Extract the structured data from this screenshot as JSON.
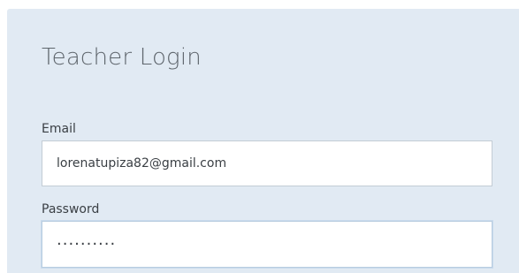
{
  "login": {
    "title": "Teacher Login",
    "email_label": "Email",
    "email_value": "lorenatupiza82@gmail.com",
    "password_label": "Password",
    "password_value": "··········"
  }
}
